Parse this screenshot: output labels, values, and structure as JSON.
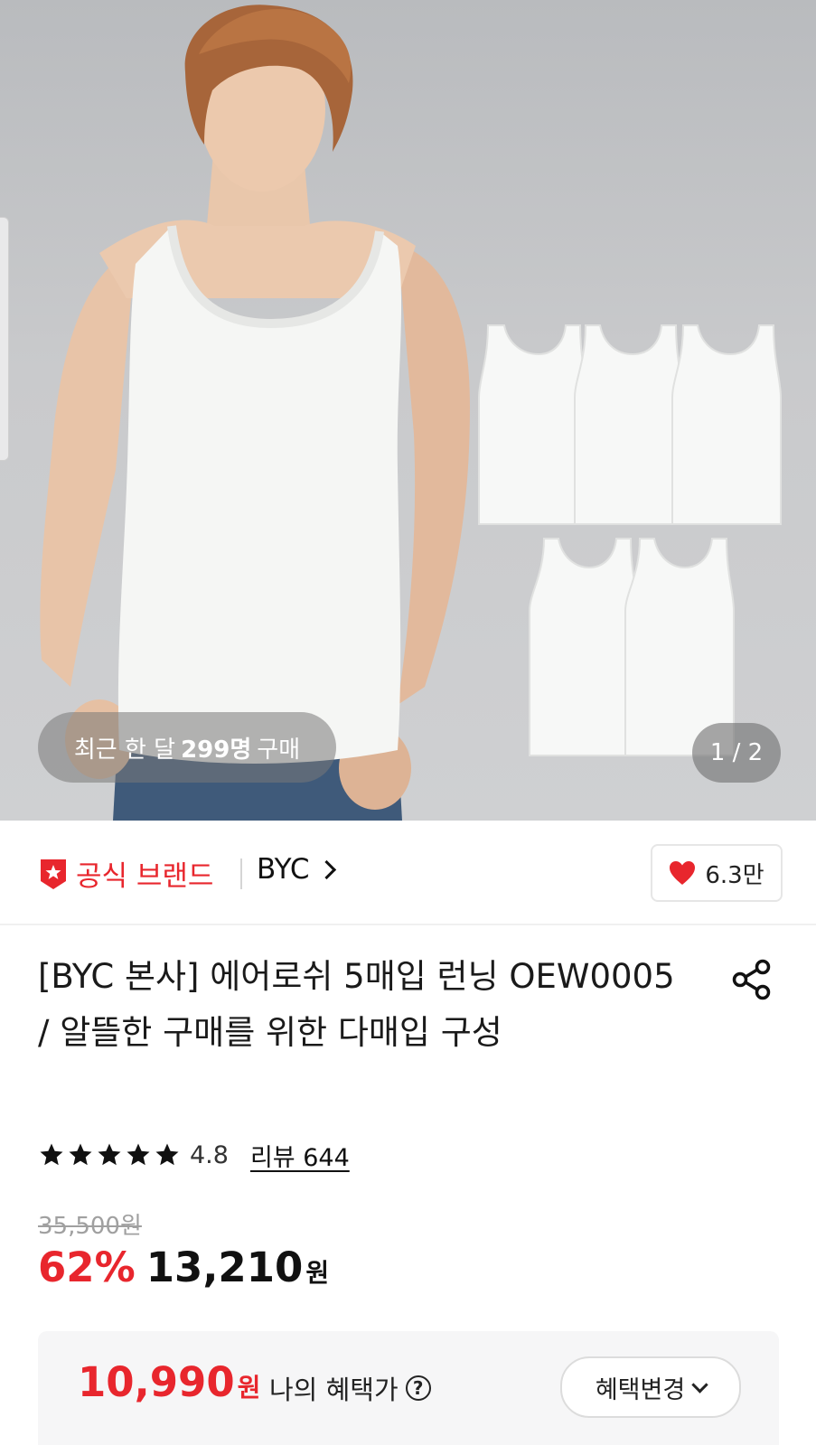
{
  "hero": {
    "buyers_prefix": "최근 한 달",
    "buyers_count": "299명",
    "buyers_suffix": "구매",
    "page_indicator": "1 / 2"
  },
  "brand": {
    "official_label": "공식 브랜드",
    "name": "BYC",
    "like_count": "6.3만"
  },
  "product": {
    "title": "[BYC 본사] 에어로쉬 5매입 런닝 OEW0005 / 알뜰한 구매를 위한 다매입 구성",
    "rating": "4.8",
    "stars": 5,
    "review_label": "리뷰 644",
    "original_price": "35,500원",
    "discount": "62%",
    "price": "13,210",
    "currency": "원"
  },
  "benefit": {
    "price": "10,990",
    "currency": "원",
    "label": "나의 혜택가",
    "help": "?",
    "change_label": "혜택변경"
  },
  "colors": {
    "accent_red": "#e8262d"
  }
}
